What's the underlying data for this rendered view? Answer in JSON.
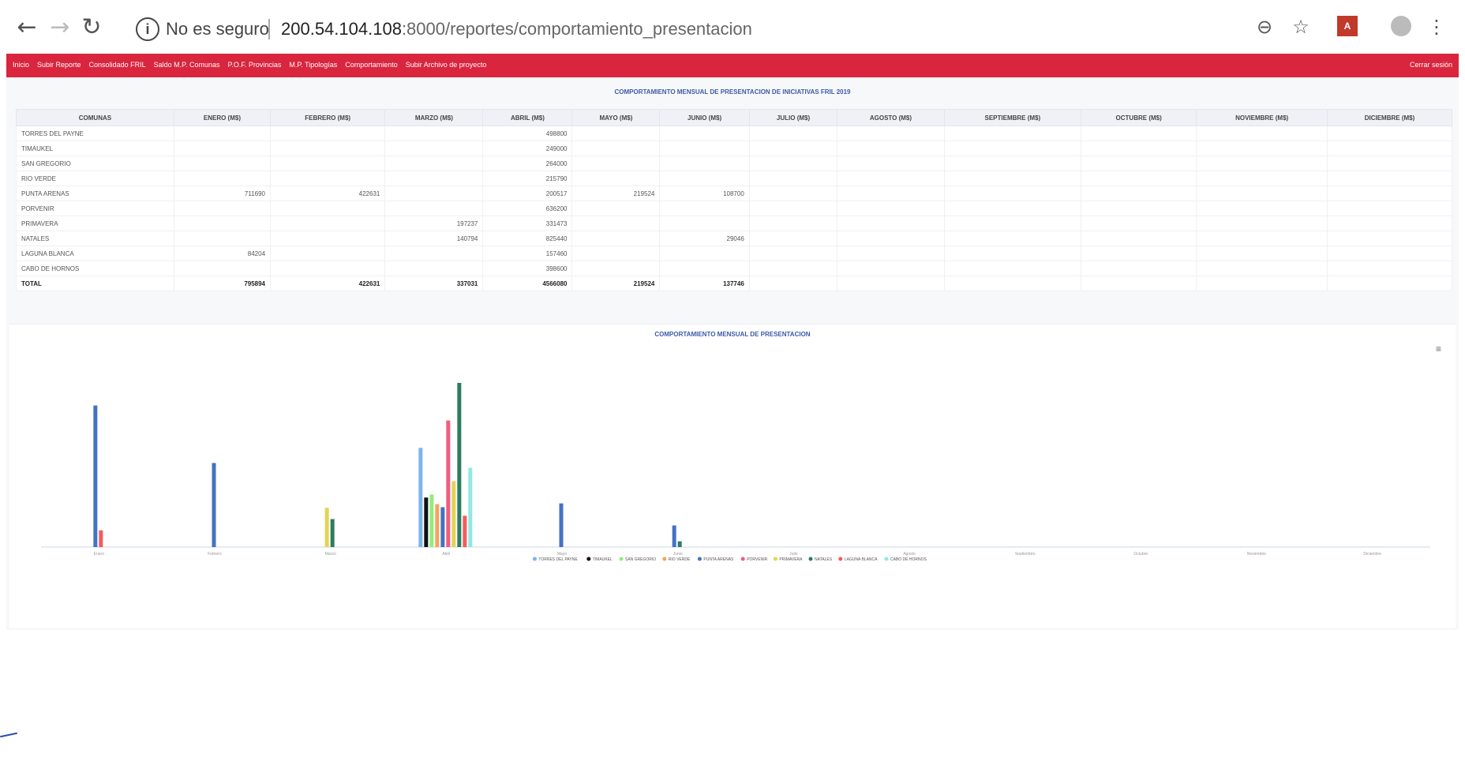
{
  "browser": {
    "insecure_label": "No es seguro",
    "url_host": "200.54.104.108",
    "url_path": ":8000/reportes/comportamiento_presentacion"
  },
  "nav": {
    "items": [
      "Inicio",
      "Subir Reporte",
      "Consolidado FRIL",
      "Saldo M.P. Comunas",
      "P.O.F. Provincias",
      "M.P. Tipologías",
      "Comportamiento",
      "Subir Archivo de proyecto"
    ],
    "user": "Cerrar sesión"
  },
  "table": {
    "title": "COMPORTAMIENTO MENSUAL DE PRESENTACION DE INICIATIVAS FRIL 2019",
    "headers": [
      "COMUNAS",
      "ENERO (M$)",
      "FEBRERO (M$)",
      "MARZO (M$)",
      "ABRIL (M$)",
      "MAYO (M$)",
      "JUNIO (M$)",
      "JULIO (M$)",
      "AGOSTO (M$)",
      "SEPTIEMBRE (M$)",
      "OCTUBRE (M$)",
      "NOVIEMBRE (M$)",
      "DICIEMBRE (M$)"
    ],
    "rows": [
      [
        "TORRES DEL PAYNE",
        "",
        "",
        "",
        "498800",
        "",
        "",
        "",
        "",
        "",
        "",
        "",
        ""
      ],
      [
        "TIMAUKEL",
        "",
        "",
        "",
        "249000",
        "",
        "",
        "",
        "",
        "",
        "",
        "",
        ""
      ],
      [
        "SAN GREGORIO",
        "",
        "",
        "",
        "264000",
        "",
        "",
        "",
        "",
        "",
        "",
        "",
        ""
      ],
      [
        "RIO VERDE",
        "",
        "",
        "",
        "215790",
        "",
        "",
        "",
        "",
        "",
        "",
        "",
        ""
      ],
      [
        "PUNTA ARENAS",
        "711690",
        "422631",
        "",
        "200517",
        "219524",
        "108700",
        "",
        "",
        "",
        "",
        "",
        ""
      ],
      [
        "PORVENIR",
        "",
        "",
        "",
        "636200",
        "",
        "",
        "",
        "",
        "",
        "",
        "",
        ""
      ],
      [
        "PRIMAVERA",
        "",
        "",
        "197237",
        "331473",
        "",
        "",
        "",
        "",
        "",
        "",
        "",
        ""
      ],
      [
        "NATALES",
        "",
        "",
        "140794",
        "825440",
        "",
        "29046",
        "",
        "",
        "",
        "",
        "",
        ""
      ],
      [
        "LAGUNA BLANCA",
        "84204",
        "",
        "",
        "157460",
        "",
        "",
        "",
        "",
        "",
        "",
        "",
        ""
      ],
      [
        "CABO DE HORNOS",
        "",
        "",
        "",
        "398600",
        "",
        "",
        "",
        "",
        "",
        "",
        "",
        ""
      ]
    ],
    "total": [
      "TOTAL",
      "795894",
      "422631",
      "337031",
      "4566080",
      "219524",
      "137746",
      "",
      "",
      "",
      "",
      "",
      ""
    ]
  },
  "chart_data": {
    "type": "bar",
    "title": "COMPORTAMIENTO MENSUAL DE PRESENTACION",
    "categories": [
      "Enero",
      "Febrero",
      "Marzo",
      "Abril",
      "Mayo",
      "Junio",
      "Julio",
      "Agosto",
      "Septiembre",
      "Octubre",
      "Noviembre",
      "Diciembre"
    ],
    "series": [
      {
        "name": "TORRES DEL PAYNE",
        "color": "#7cb5ec",
        "values": [
          0,
          0,
          0,
          498800,
          0,
          0,
          0,
          0,
          0,
          0,
          0,
          0
        ]
      },
      {
        "name": "TIMAUKEL",
        "color": "#111111",
        "values": [
          0,
          0,
          0,
          249000,
          0,
          0,
          0,
          0,
          0,
          0,
          0,
          0
        ]
      },
      {
        "name": "SAN GREGORIO",
        "color": "#90ed7d",
        "values": [
          0,
          0,
          0,
          264000,
          0,
          0,
          0,
          0,
          0,
          0,
          0,
          0
        ]
      },
      {
        "name": "RIO VERDE",
        "color": "#f7a35c",
        "values": [
          0,
          0,
          0,
          215790,
          0,
          0,
          0,
          0,
          0,
          0,
          0,
          0
        ]
      },
      {
        "name": "PUNTA ARENAS",
        "color": "#4472c4",
        "values": [
          711690,
          422631,
          0,
          200517,
          219524,
          108700,
          0,
          0,
          0,
          0,
          0,
          0
        ]
      },
      {
        "name": "PORVENIR",
        "color": "#f15c80",
        "values": [
          0,
          0,
          0,
          636200,
          0,
          0,
          0,
          0,
          0,
          0,
          0,
          0
        ]
      },
      {
        "name": "PRIMAVERA",
        "color": "#e4d354",
        "values": [
          0,
          0,
          197237,
          331473,
          0,
          0,
          0,
          0,
          0,
          0,
          0,
          0
        ]
      },
      {
        "name": "NATALES",
        "color": "#2b7d5e",
        "values": [
          0,
          0,
          140794,
          825440,
          0,
          29046,
          0,
          0,
          0,
          0,
          0,
          0
        ]
      },
      {
        "name": "LAGUNA BLANCA",
        "color": "#f45b5b",
        "values": [
          84204,
          0,
          0,
          157460,
          0,
          0,
          0,
          0,
          0,
          0,
          0,
          0
        ]
      },
      {
        "name": "CABO DE HORNOS",
        "color": "#91e8e1",
        "values": [
          0,
          0,
          0,
          398600,
          0,
          0,
          0,
          0,
          0,
          0,
          0,
          0
        ]
      }
    ],
    "ylim": [
      0,
      1000000
    ],
    "legend": "bottom-center"
  }
}
